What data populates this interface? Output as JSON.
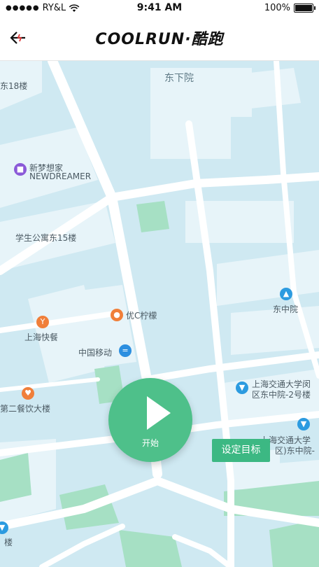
{
  "statusbar": {
    "carrier": "RY&L",
    "time": "9:41 AM",
    "battery": "100%"
  },
  "nav": {
    "brand": "COOLRUN·酷跑"
  },
  "map": {
    "labels": {
      "dongxiayuan": "东下院",
      "dong18": "东18楼",
      "xinmeng": "新梦想家",
      "newdreamer": "NEWDREAMER",
      "xuesheng": "学生公寓东15楼",
      "youc": "优C柠檬",
      "shanghai_kuaican": "上海快餐",
      "china_mobile": "中国移动",
      "dier": "第二餐饮大楼",
      "dongzhongyuan": "东中院",
      "sjtu1": "上海交通大学闵",
      "sjtu2": "区东中院-2号楼",
      "sjtu3": "上海交通大学",
      "sjtu4": "区)东中院-",
      "lou": "楼"
    }
  },
  "start_button": {
    "label": "开始"
  },
  "goal_button": {
    "label": "设定目标"
  },
  "colors": {
    "accent": "#4ec08a",
    "map_bg": "#cfe9f2",
    "road": "#ffffff",
    "green": "#a6e0c4"
  }
}
